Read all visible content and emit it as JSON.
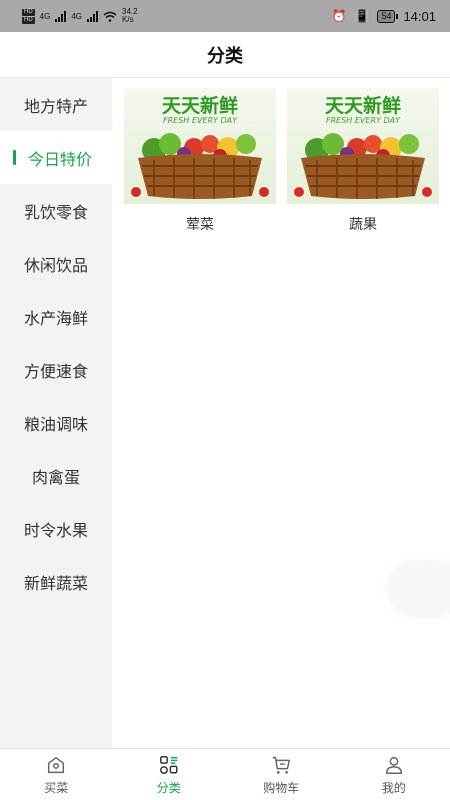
{
  "status_bar": {
    "hd1": "HD",
    "hd2": "HD",
    "net1": "4G",
    "net2": "4G",
    "speed": "34.2",
    "speed_unit": "K/s",
    "battery": "54",
    "time": "14:01"
  },
  "header": {
    "title": "分类"
  },
  "sidebar": {
    "items": [
      {
        "label": "地方特产"
      },
      {
        "label": "今日特价"
      },
      {
        "label": "乳饮零食"
      },
      {
        "label": "休闲饮品"
      },
      {
        "label": "水产海鲜"
      },
      {
        "label": "方便速食"
      },
      {
        "label": "粮油调味"
      },
      {
        "label": "肉禽蛋"
      },
      {
        "label": "时令水果"
      },
      {
        "label": "新鲜蔬菜"
      }
    ],
    "active_index": 1
  },
  "products": [
    {
      "name": "荤菜",
      "banner_title": "天天新鲜",
      "banner_subtitle": "FRESH EVERY DAY"
    },
    {
      "name": "蔬果",
      "banner_title": "天天新鲜",
      "banner_subtitle": "FRESH EVERY DAY"
    }
  ],
  "tabbar": {
    "items": [
      {
        "label": "买菜",
        "icon": "home-icon"
      },
      {
        "label": "分类",
        "icon": "category-icon"
      },
      {
        "label": "购物车",
        "icon": "cart-icon"
      },
      {
        "label": "我的",
        "icon": "profile-icon"
      }
    ],
    "active_index": 1
  },
  "colors": {
    "accent": "#1aa34a",
    "status_bar": "#a9a9a9",
    "sidebar_bg": "#f3f3f3"
  }
}
